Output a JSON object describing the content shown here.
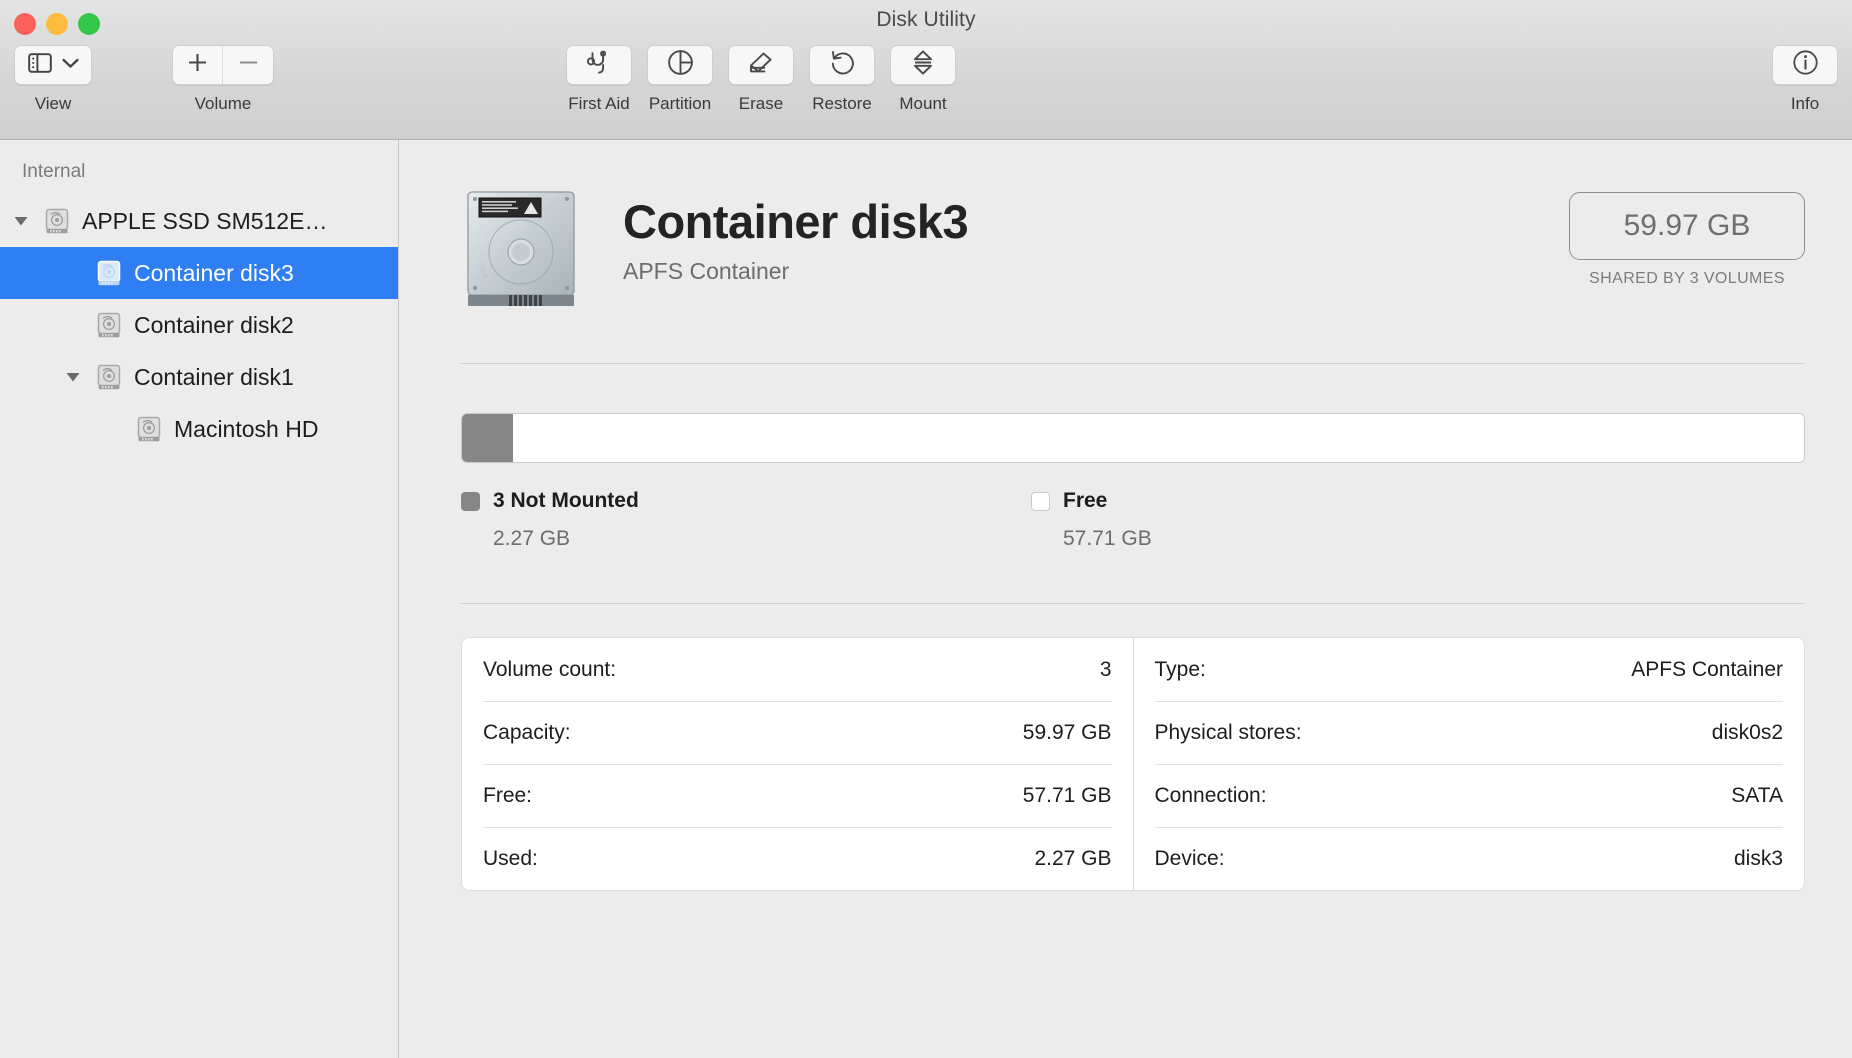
{
  "window": {
    "title": "Disk Utility",
    "traffic_lights": [
      "close",
      "minimize",
      "zoom"
    ]
  },
  "toolbar": {
    "view": {
      "label": "View",
      "icon": "sidebar-icon",
      "chevron": "chevron-down-icon"
    },
    "volume": {
      "label": "Volume",
      "add": "+",
      "remove": "—"
    },
    "actions": [
      {
        "label": "First Aid",
        "icon": "stethoscope-icon"
      },
      {
        "label": "Partition",
        "icon": "pie-chart-icon"
      },
      {
        "label": "Erase",
        "icon": "eraser-icon"
      },
      {
        "label": "Restore",
        "icon": "undo-arrow-icon"
      },
      {
        "label": "Mount",
        "icon": "eject-icon"
      }
    ],
    "info": {
      "label": "Info",
      "icon": "info-circle-icon"
    }
  },
  "sidebar": {
    "section_header": "Internal",
    "items": [
      {
        "label": "APPLE SSD SM512E…",
        "level": 1,
        "expanded": true,
        "selected": false,
        "has_twisty": true
      },
      {
        "label": "Container disk3",
        "level": 2,
        "expanded": false,
        "selected": true,
        "has_twisty": false
      },
      {
        "label": "Container disk2",
        "level": 2,
        "expanded": false,
        "selected": false,
        "has_twisty": false
      },
      {
        "label": "Container disk1",
        "level": 2,
        "expanded": true,
        "selected": false,
        "has_twisty": true
      },
      {
        "label": "Macintosh HD",
        "level": 3,
        "expanded": false,
        "selected": false,
        "has_twisty": false
      }
    ]
  },
  "main": {
    "title": "Container disk3",
    "subtitle": "APFS Container",
    "capacity_badge": "59.97 GB",
    "capacity_note": "SHARED BY 3 VOLUMES",
    "legend": [
      {
        "name": "3 Not Mounted",
        "value": "2.27 GB",
        "color": "#868686"
      },
      {
        "name": "Free",
        "value": "57.71 GB",
        "color": "#ffffff"
      }
    ],
    "info_left": [
      {
        "label": "Volume count:",
        "value": "3"
      },
      {
        "label": "Capacity:",
        "value": "59.97 GB"
      },
      {
        "label": "Free:",
        "value": "57.71 GB"
      },
      {
        "label": "Used:",
        "value": "2.27 GB"
      }
    ],
    "info_right": [
      {
        "label": "Type:",
        "value": "APFS Container"
      },
      {
        "label": "Physical stores:",
        "value": "disk0s2"
      },
      {
        "label": "Connection:",
        "value": "SATA"
      },
      {
        "label": "Device:",
        "value": "disk3"
      }
    ]
  },
  "chart_data": {
    "type": "bar",
    "title": "Container disk3 storage usage",
    "categories": [
      "3 Not Mounted",
      "Free"
    ],
    "values": [
      2.27,
      57.71
    ],
    "unit": "GB",
    "total": 59.97,
    "percentages": [
      3.8,
      96.2
    ],
    "colors": [
      "#868686",
      "#ffffff"
    ],
    "orientation": "horizontal-stacked",
    "xlabel": "",
    "ylabel": "",
    "legend_position": "below"
  }
}
